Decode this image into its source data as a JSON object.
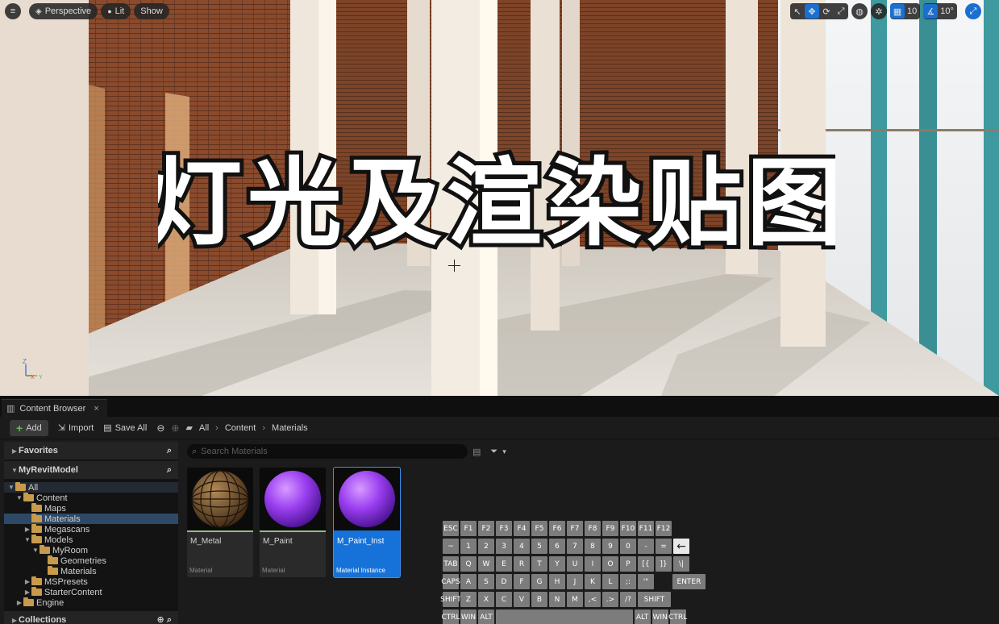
{
  "viewport": {
    "menu_icon": "hamburger-icon",
    "perspective_label": "Perspective",
    "lit_label": "Lit",
    "show_label": "Show",
    "grid_snap_value": "10",
    "angle_snap_value": "10°",
    "overlay_title": "灯光及渲染贴图",
    "axis_z": "Z",
    "axis_x": "X",
    "axis_y": "Y"
  },
  "content_browser": {
    "tab_label": "Content Browser",
    "tab_close": "×",
    "toolbar": {
      "add_label": "Add",
      "import_label": "Import",
      "save_all_label": "Save All"
    },
    "breadcrumbs": [
      "All",
      "Content",
      "Materials"
    ],
    "favorites_label": "Favorites",
    "project_label": "MyRevitModel",
    "collections_label": "Collections",
    "tree": [
      {
        "label": "All"
      },
      {
        "label": "Content"
      },
      {
        "label": "Maps"
      },
      {
        "label": "Materials"
      },
      {
        "label": "Megascans"
      },
      {
        "label": "Models"
      },
      {
        "label": "MyRoom"
      },
      {
        "label": "Geometries"
      },
      {
        "label": "Materials"
      },
      {
        "label": "MSPresets"
      },
      {
        "label": "StarterContent"
      },
      {
        "label": "Engine"
      }
    ],
    "search_placeholder": "Search Materials",
    "assets": [
      {
        "name": "M_Metal",
        "type": "Material"
      },
      {
        "name": "M_Paint",
        "type": "Material"
      },
      {
        "name": "M_Paint_Inst",
        "type": "Material Instance"
      }
    ]
  },
  "keyboard": {
    "rows": [
      [
        "ESC",
        "F1",
        "F2",
        "F3",
        "F4",
        "F5",
        "F6",
        "F7",
        "F8",
        "F9",
        "F10",
        "F11",
        "F12"
      ],
      [
        "~",
        "1",
        "2",
        "3",
        "4",
        "5",
        "6",
        "7",
        "8",
        "9",
        "0",
        "-",
        "=",
        "←"
      ],
      [
        "TAB",
        "Q",
        "W",
        "E",
        "R",
        "T",
        "Y",
        "U",
        "I",
        "O",
        "P",
        "[{",
        "]}",
        "\\|"
      ],
      [
        "CAPS",
        "A",
        "S",
        "D",
        "F",
        "G",
        "H",
        "J",
        "K",
        "L",
        ";:",
        "'\"",
        "ENTER"
      ],
      [
        "SHIFT",
        "Z",
        "X",
        "C",
        "V",
        "B",
        "N",
        "M",
        ",<",
        ".>",
        "/?",
        "SHIFT"
      ],
      [
        "CTRL",
        "WIN",
        "ALT",
        "",
        "ALT",
        "WIN",
        "CTRL"
      ]
    ]
  }
}
